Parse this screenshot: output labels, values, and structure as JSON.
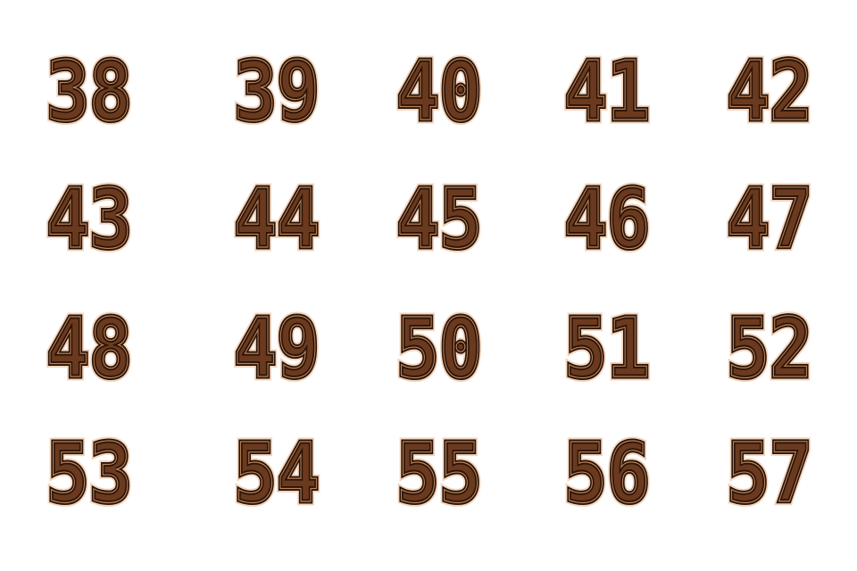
{
  "grid": {
    "numbers": [
      "38",
      "39",
      "40",
      "41",
      "42",
      "43",
      "44",
      "45",
      "46",
      "47",
      "48",
      "49",
      "50",
      "51",
      "52",
      "53",
      "54",
      "55",
      "56",
      "57"
    ]
  },
  "colors": {
    "outline_dark": "#2a1408",
    "fill_brown": "#6b3a1e",
    "glow_tan": "#e8b48a",
    "inner_line": "#c98d63"
  }
}
